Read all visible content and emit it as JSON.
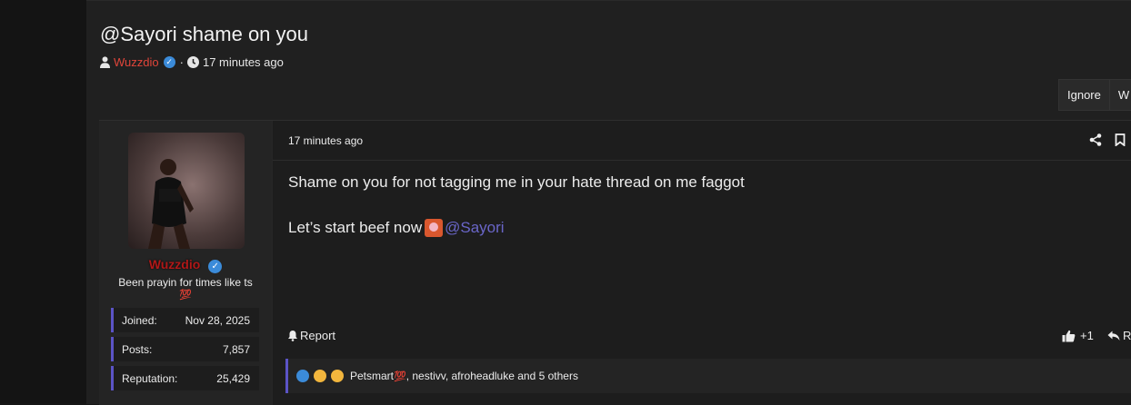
{
  "thread": {
    "title": "@Sayori shame on you",
    "author": "Wuzzdio",
    "posted": "17 minutes ago",
    "separator": "·"
  },
  "actions": {
    "ignore": "Ignore",
    "watch": "W"
  },
  "user": {
    "name": "Wuzzdio",
    "title": "Been prayin for times like ts",
    "heart": "💯",
    "stats": [
      {
        "label": "Joined:",
        "value": "Nov 28, 2025"
      },
      {
        "label": "Posts:",
        "value": "7,857"
      },
      {
        "label": "Reputation:",
        "value": "25,429"
      }
    ]
  },
  "post": {
    "time": "17 minutes ago",
    "line1": "Shame on you for not tagging me in your hate thread on me faggot",
    "line2": "Let’s start beef now",
    "mention": "@Sayori",
    "report": "Report",
    "like": "+1",
    "reply": "Re"
  },
  "reactions": {
    "first_user": "Petsmart",
    "heart": "💯",
    "rest": ", nestivv, afroheadluke and 5 others"
  },
  "colors": {
    "accent": "#5b54c6",
    "author": "#e0453a",
    "mention": "#6a66c9",
    "verified": "#3b8bd9"
  },
  "icons": [
    "user-icon",
    "verified-icon",
    "clock-icon",
    "share-icon",
    "bookmark-icon",
    "bell-icon",
    "thumbs-up-icon",
    "reply-icon",
    "like-reaction-icon",
    "haha-reaction-icon",
    "cry-reaction-icon"
  ]
}
